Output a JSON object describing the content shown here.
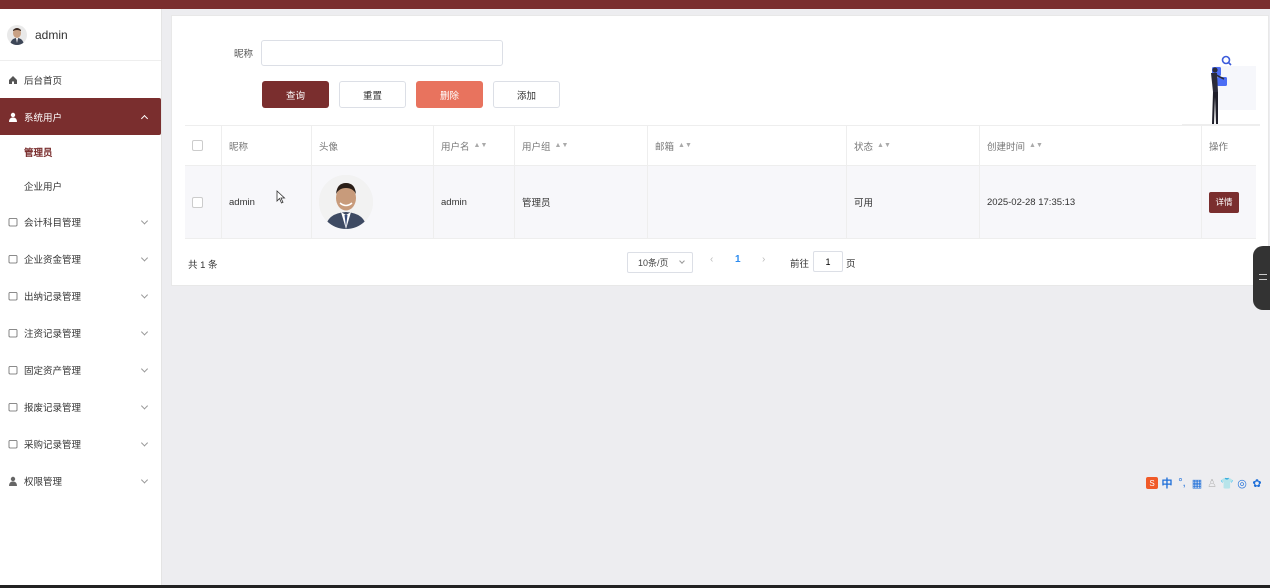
{
  "sidebar": {
    "username": "admin",
    "menu": [
      {
        "label": "后台首页",
        "icon": "home-icon"
      },
      {
        "label": "系统用户",
        "icon": "user-icon"
      },
      {
        "label": "会计科目管理",
        "icon": "folder-icon"
      },
      {
        "label": "企业资金管理",
        "icon": "folder-icon"
      },
      {
        "label": "出纳记录管理",
        "icon": "folder-icon"
      },
      {
        "label": "注资记录管理",
        "icon": "folder-icon"
      },
      {
        "label": "固定资产管理",
        "icon": "folder-icon"
      },
      {
        "label": "报废记录管理",
        "icon": "folder-icon"
      },
      {
        "label": "采购记录管理",
        "icon": "folder-icon"
      },
      {
        "label": "权限管理",
        "icon": "user-icon"
      }
    ],
    "submenu": [
      "管理员",
      "企业用户"
    ]
  },
  "search": {
    "label": "昵称",
    "value": "",
    "placeholder": ""
  },
  "buttons": {
    "query": "查询",
    "reset": "重置",
    "delete": "删除",
    "add": "添加"
  },
  "table": {
    "headers": [
      "昵称",
      "头像",
      "用户名",
      "用户组",
      "邮箱",
      "状态",
      "创建时间",
      "操作"
    ],
    "rows": [
      {
        "nickname": "admin",
        "username": "admin",
        "group": "管理员",
        "email": "",
        "status": "可用",
        "created": "2025-02-28 17:35:13",
        "action": "详情"
      }
    ]
  },
  "pagination": {
    "total": "共 1 条",
    "page_size": "10条/页",
    "current": "1",
    "goto_label": "前往",
    "goto_value": "1",
    "goto_suffix": "页"
  },
  "ime": {
    "zh": "中"
  },
  "colors": {
    "brand": "#7a2e2e",
    "danger": "#e8735e",
    "link": "#2d8cf0"
  }
}
